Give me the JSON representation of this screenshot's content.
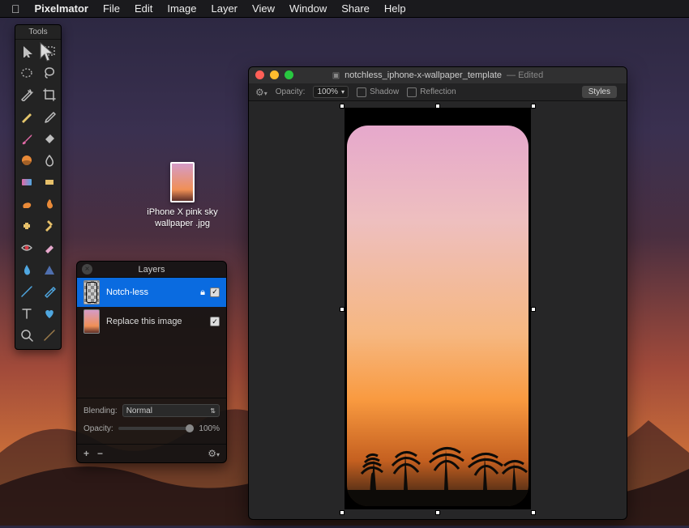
{
  "menubar": {
    "app": "Pixelmator",
    "items": [
      "File",
      "Edit",
      "Image",
      "Layer",
      "View",
      "Window",
      "Share",
      "Help"
    ]
  },
  "tools": {
    "title": "Tools",
    "items": [
      [
        "move",
        "M4 2 L4 17 L8 13 L11 19 L13 18 L10 12 L15 12 Z",
        "#bfbfbf"
      ],
      [
        "marquee-rect",
        "M2 3 H14 V13 H2 Z",
        "#bfbfbf",
        "dash"
      ],
      [
        "marquee-ellipse",
        "ellipse",
        "#bfbfbf",
        "dash"
      ],
      [
        "lasso",
        "M8 2 C3 2 2 6 4 9 C6 12 12 11 13 8 C14 5 12 2 8 2 M4 9 Q2 13 5 14",
        "#bfbfbf",
        "stroke"
      ],
      [
        "wand",
        "M2 14 L12 4 L14 6 L4 16 Z M12 2 L13 4 M15 5 L13 6 M10 3 L11 4",
        "#bfbfbf",
        "stroke"
      ],
      [
        "crop",
        "M3 1 V13 H15 M1 3 H13 V15",
        "#bfbfbf",
        "stroke"
      ],
      [
        "pencil",
        "M2 14 L12 4 L14 6 L4 16 Z",
        "#e4c66c"
      ],
      [
        "eyedropper",
        "M13 3 L15 5 L6 14 L3 15 L4 12 Z",
        "#bfbfbf",
        "stroke"
      ],
      [
        "brush",
        "M3 13 Q2 16 5 15 Q8 14 6 11 Z M6 11 L13 4 Q15 2 14 5 L7 12",
        "#e26aa6"
      ],
      [
        "bucket",
        "M3 9 L9 3 L14 8 L8 14 Z",
        "#bfbfbf"
      ],
      [
        "paint",
        "circle",
        "#e98a38",
        "fill"
      ],
      [
        "blur",
        "M8 2 C4 7 3 10 5 13 C7 16 11 15 12 12 C13 9 11 6 8 2 Z",
        "#bfbfbf",
        "stroke"
      ],
      [
        "gradient",
        "rectgrad",
        "",
        ""
      ],
      [
        "sponge",
        "M3 5 H13 V11 H3 Z",
        "#e6c06a"
      ],
      [
        "smudge",
        "M4 13 Q2 9 6 7 Q11 5 13 8 Q14 11 10 13 Z",
        "#e98a38"
      ],
      [
        "burn",
        "M8 2 C5 6 4 9 6 12 C8 15 12 13 12 10 C12 8 10 7 10 5 C10 3 9 3 8 2 Z",
        "#e98a38"
      ],
      [
        "heal",
        "M4 6 H6 V4 H10 V6 H12 V10 H10 V12 H6 V10 H4 Z",
        "#e6c06a"
      ],
      [
        "clone",
        "M5 3 L7 1 L12 6 L10 8 Z M3 13 L9 7 L11 9 L5 15 Z",
        "#e6c06a"
      ],
      [
        "redeye",
        "M2 8 Q8 2 14 8 Q8 14 2 8 Z",
        "#d63c46",
        "eye"
      ],
      [
        "eraser",
        "M3 12 L10 5 L13 8 L6 15 Z",
        "#e6a8cc"
      ],
      [
        "drop",
        "M8 2 C5 7 4 10 6 13 C8 16 12 14 12 11 C12 8 10 6 8 2 Z",
        "#4fa7e0"
      ],
      [
        "shape",
        "M2 14 L8 3 L14 14 Z",
        "#4f6fae"
      ],
      [
        "line",
        "M2 14 L14 2",
        "#4fa7e0",
        "stroke"
      ],
      [
        "pen",
        "M3 13 L11 5 L13 7 L5 15 Z M11 5 L13 3 L15 5 L13 7",
        "#4fa7e0",
        "stroke"
      ],
      [
        "text",
        "M3 3 H13 M8 3 V14",
        "#bfbfbf",
        "stroke"
      ],
      [
        "heart",
        "M8 14 C2 9 2 4 6 4 C8 4 8 6 8 6 C8 6 8 4 10 4 C14 4 14 9 8 14 Z",
        "#4fa7e0"
      ],
      [
        "zoom",
        "M7 2 A5 5 0 1 0 7 12 A5 5 0 1 0 7 2 M11 11 L15 15",
        "#bfbfbf",
        "stroke"
      ],
      [
        "hand",
        "M2 14 L14 2",
        "#9a7a4a",
        "stroke"
      ]
    ]
  },
  "desktop_file": {
    "name_line1": "iPhone X pink sky",
    "name_line2": "wallpaper .jpg"
  },
  "layers_panel": {
    "title": "Layers",
    "rows": [
      {
        "name": "Notch-less",
        "selected": true,
        "locked": true,
        "visible": true,
        "thumb": "notch"
      },
      {
        "name": "Replace this image",
        "selected": false,
        "locked": false,
        "visible": true,
        "thumb": "sun"
      }
    ],
    "blending_label": "Blending:",
    "blending_value": "Normal",
    "opacity_label": "Opacity:",
    "opacity_value": "100%"
  },
  "document": {
    "filename": "notchless_iphone-x-wallpaper_template",
    "status": "Edited",
    "toolbar": {
      "opacity_label": "Opacity:",
      "opacity_value": "100%",
      "shadow": "Shadow",
      "reflection": "Reflection",
      "styles": "Styles"
    }
  }
}
